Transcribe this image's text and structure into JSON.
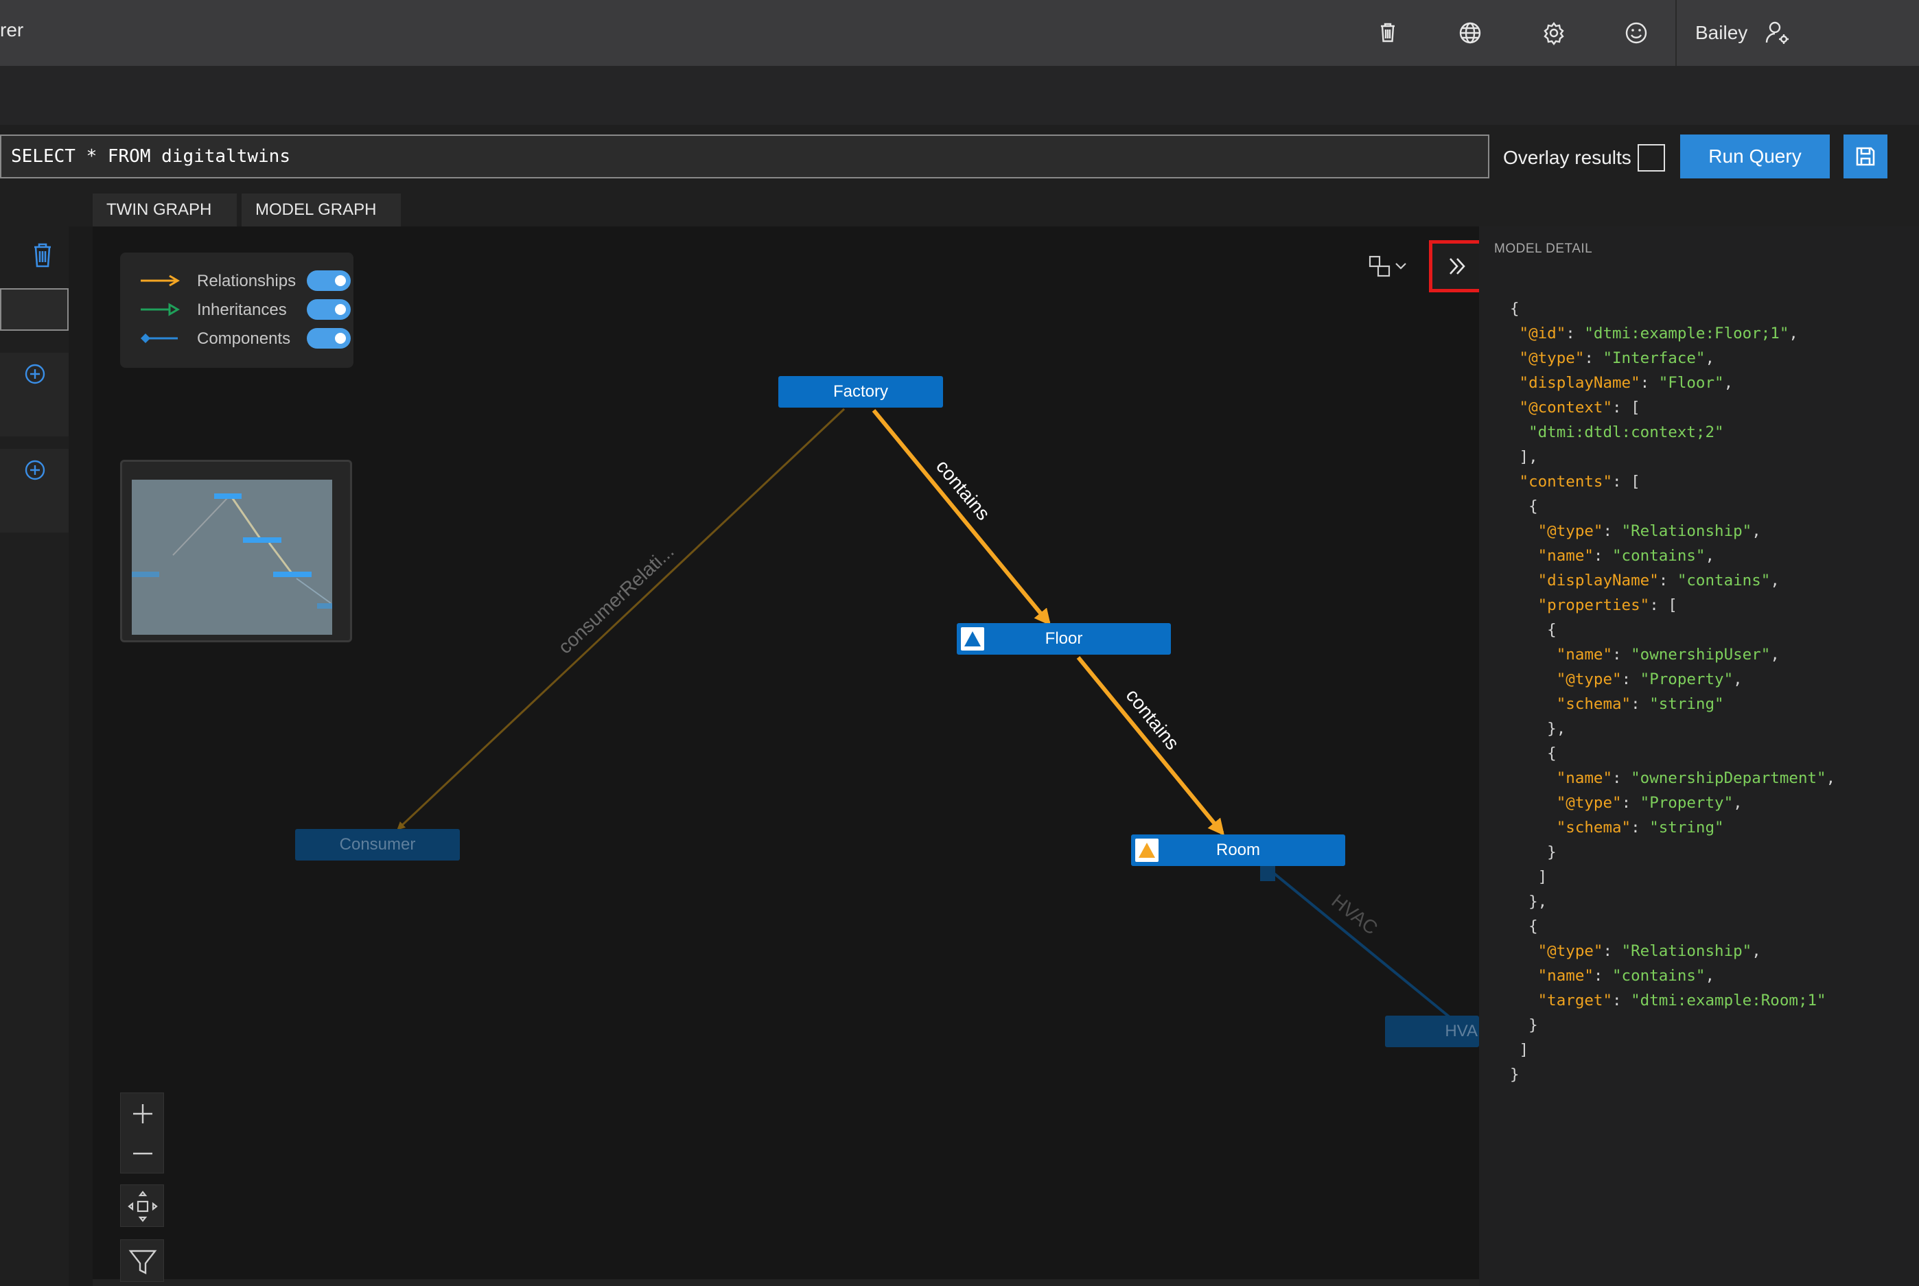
{
  "header": {
    "app_title_fragment": "rer",
    "user_name": "Bailey",
    "icons": [
      "trash-icon",
      "globe-icon",
      "gear-icon",
      "smiley-icon",
      "user-settings-icon"
    ]
  },
  "query": {
    "text": "SELECT * FROM digitaltwins",
    "overlay_label": "Overlay results",
    "overlay_checked": false,
    "run_label": "Run Query"
  },
  "tabs": [
    {
      "label": "TWIN GRAPH"
    },
    {
      "label": "MODEL GRAPH"
    }
  ],
  "legend": {
    "items": [
      {
        "label": "Relationships",
        "color": "#f5a623",
        "enabled": true
      },
      {
        "label": "Inheritances",
        "color": "#1fa05a",
        "enabled": true
      },
      {
        "label": "Components",
        "color": "#2b88d8",
        "enabled": true
      }
    ]
  },
  "graph": {
    "nodes": [
      {
        "label": "Factory"
      },
      {
        "label": "Floor"
      },
      {
        "label": "Room"
      },
      {
        "label": "Consumer"
      },
      {
        "label": "HVA"
      }
    ],
    "edges": [
      {
        "label": "contains"
      },
      {
        "label": "contains"
      },
      {
        "label": "consumerRelati..."
      },
      {
        "label": "HVAC"
      }
    ]
  },
  "model_detail": {
    "title": "MODEL DETAIL",
    "json_lines": [
      [
        [
          "p",
          "{"
        ]
      ],
      [
        [
          "p",
          " "
        ],
        [
          "k",
          "\"@id\""
        ],
        [
          "p",
          ": "
        ],
        [
          "v",
          "\"dtmi:example:Floor;1\""
        ],
        [
          "p",
          ","
        ]
      ],
      [
        [
          "p",
          " "
        ],
        [
          "k",
          "\"@type\""
        ],
        [
          "p",
          ": "
        ],
        [
          "v",
          "\"Interface\""
        ],
        [
          "p",
          ","
        ]
      ],
      [
        [
          "p",
          " "
        ],
        [
          "k",
          "\"displayName\""
        ],
        [
          "p",
          ": "
        ],
        [
          "v",
          "\"Floor\""
        ],
        [
          "p",
          ","
        ]
      ],
      [
        [
          "p",
          " "
        ],
        [
          "k",
          "\"@context\""
        ],
        [
          "p",
          ": ["
        ]
      ],
      [
        [
          "p",
          "  "
        ],
        [
          "v",
          "\"dtmi:dtdl:context;2\""
        ]
      ],
      [
        [
          "p",
          " ],"
        ]
      ],
      [
        [
          "p",
          " "
        ],
        [
          "k",
          "\"contents\""
        ],
        [
          "p",
          ": ["
        ]
      ],
      [
        [
          "p",
          "  {"
        ]
      ],
      [
        [
          "p",
          "   "
        ],
        [
          "k",
          "\"@type\""
        ],
        [
          "p",
          ": "
        ],
        [
          "v",
          "\"Relationship\""
        ],
        [
          "p",
          ","
        ]
      ],
      [
        [
          "p",
          "   "
        ],
        [
          "k",
          "\"name\""
        ],
        [
          "p",
          ": "
        ],
        [
          "v",
          "\"contains\""
        ],
        [
          "p",
          ","
        ]
      ],
      [
        [
          "p",
          "   "
        ],
        [
          "k",
          "\"displayName\""
        ],
        [
          "p",
          ": "
        ],
        [
          "v",
          "\"contains\""
        ],
        [
          "p",
          ","
        ]
      ],
      [
        [
          "p",
          "   "
        ],
        [
          "k",
          "\"properties\""
        ],
        [
          "p",
          ": ["
        ]
      ],
      [
        [
          "p",
          "    {"
        ]
      ],
      [
        [
          "p",
          "     "
        ],
        [
          "k",
          "\"name\""
        ],
        [
          "p",
          ": "
        ],
        [
          "v",
          "\"ownershipUser\""
        ],
        [
          "p",
          ","
        ]
      ],
      [
        [
          "p",
          "     "
        ],
        [
          "k",
          "\"@type\""
        ],
        [
          "p",
          ": "
        ],
        [
          "v",
          "\"Property\""
        ],
        [
          "p",
          ","
        ]
      ],
      [
        [
          "p",
          "     "
        ],
        [
          "k",
          "\"schema\""
        ],
        [
          "p",
          ": "
        ],
        [
          "v",
          "\"string\""
        ]
      ],
      [
        [
          "p",
          "    },"
        ]
      ],
      [
        [
          "p",
          "    {"
        ]
      ],
      [
        [
          "p",
          "     "
        ],
        [
          "k",
          "\"name\""
        ],
        [
          "p",
          ": "
        ],
        [
          "v",
          "\"ownershipDepartment\""
        ],
        [
          "p",
          ","
        ]
      ],
      [
        [
          "p",
          "     "
        ],
        [
          "k",
          "\"@type\""
        ],
        [
          "p",
          ": "
        ],
        [
          "v",
          "\"Property\""
        ],
        [
          "p",
          ","
        ]
      ],
      [
        [
          "p",
          "     "
        ],
        [
          "k",
          "\"schema\""
        ],
        [
          "p",
          ": "
        ],
        [
          "v",
          "\"string\""
        ]
      ],
      [
        [
          "p",
          "    }"
        ]
      ],
      [
        [
          "p",
          "   ]"
        ]
      ],
      [
        [
          "p",
          "  },"
        ]
      ],
      [
        [
          "p",
          "  {"
        ]
      ],
      [
        [
          "p",
          "   "
        ],
        [
          "k",
          "\"@type\""
        ],
        [
          "p",
          ": "
        ],
        [
          "v",
          "\"Relationship\""
        ],
        [
          "p",
          ","
        ]
      ],
      [
        [
          "p",
          "   "
        ],
        [
          "k",
          "\"name\""
        ],
        [
          "p",
          ": "
        ],
        [
          "v",
          "\"contains\""
        ],
        [
          "p",
          ","
        ]
      ],
      [
        [
          "p",
          "   "
        ],
        [
          "k",
          "\"target\""
        ],
        [
          "p",
          ": "
        ],
        [
          "v",
          "\"dtmi:example:Room;1\""
        ]
      ],
      [
        [
          "p",
          "  }"
        ]
      ],
      [
        [
          "p",
          " ]"
        ]
      ],
      [
        [
          "p",
          "}"
        ]
      ]
    ]
  }
}
